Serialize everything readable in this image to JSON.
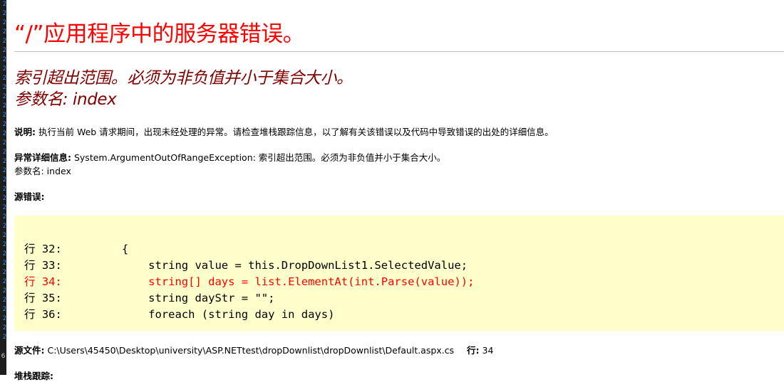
{
  "gutter": {
    "marks": [
      "2",
      "2",
      "2",
      "2",
      "2",
      "2",
      "2",
      "2",
      "2",
      "2",
      "2",
      "2",
      "2",
      "2",
      "2",
      "2",
      "2",
      "2",
      "2",
      "2",
      "2",
      "2",
      "2",
      "2",
      "2",
      "2",
      "2",
      "2",
      "2",
      "2",
      "2",
      "2",
      "2",
      "2",
      "2",
      "2",
      "2"
    ],
    "badge": "6"
  },
  "page": {
    "title": "“/”应用程序中的服务器错误。",
    "error_heading_line1": "索引超出范围。必须为非负值并小于集合大小。",
    "error_heading_line2": "参数名: index",
    "description_label": "说明:",
    "description_text": " 执行当前 Web 请求期间，出现未经处理的异常。请检查堆栈跟踪信息，以了解有关该错误以及代码中导致错误的出处的详细信息。",
    "exception_label": "异常详细信息:",
    "exception_text": " System.ArgumentOutOfRangeException: 索引超出范围。必须为非负值并小于集合大小。",
    "exception_param": "参数名: index",
    "source_error_label": "源错误:",
    "code_lines": [
      {
        "text": "行 32:         {",
        "error": false
      },
      {
        "text": "行 33:             string value = this.DropDownList1.SelectedValue;",
        "error": false
      },
      {
        "text": "行 34:             string[] days = list.ElementAt(int.Parse(value));",
        "error": true
      },
      {
        "text": "行 35:             string dayStr = \"\";",
        "error": false
      },
      {
        "text": "行 36:             foreach (string day in days)",
        "error": false
      }
    ],
    "source_file_label": "源文件:",
    "source_file_path": " C:\\Users\\45450\\Desktop\\university\\ASP.NETtest\\dropDownlist\\dropDownlist\\Default.aspx.cs",
    "line_label": "行:",
    "line_value": " 34",
    "stack_trace_label": "堆栈跟踪:"
  },
  "colors": {
    "title": "#ff0000",
    "heading": "#800000",
    "code_background": "#ffffcc",
    "error_line": "#ff0000"
  }
}
